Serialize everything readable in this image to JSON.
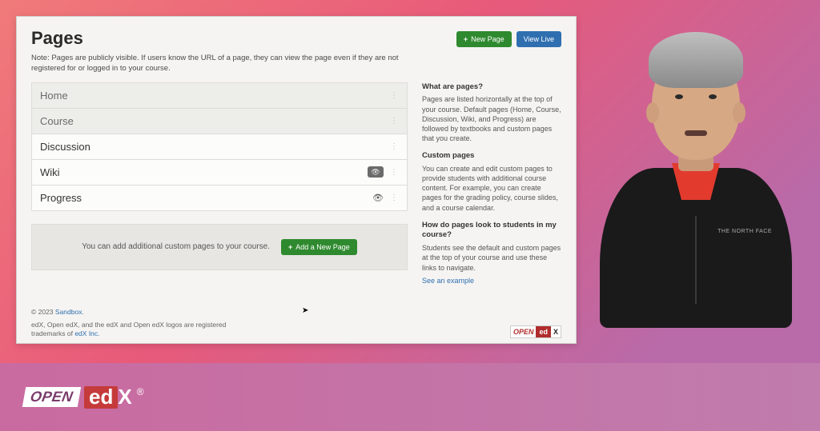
{
  "header": {
    "title": "Pages",
    "new_page_btn": "New Page",
    "view_live_btn": "View Live"
  },
  "note": "Note: Pages are publicly visible. If users know the URL of a page, they can view the page even if they are not registered for or logged in to your course.",
  "pages": [
    {
      "name": "Home",
      "active": false,
      "show_toggle": false,
      "show_eye": false
    },
    {
      "name": "Course",
      "active": false,
      "show_toggle": false,
      "show_eye": false
    },
    {
      "name": "Discussion",
      "active": true,
      "show_toggle": false,
      "show_eye": false
    },
    {
      "name": "Wiki",
      "active": true,
      "show_toggle": true,
      "show_eye": false
    },
    {
      "name": "Progress",
      "active": true,
      "show_toggle": false,
      "show_eye": true
    }
  ],
  "add_panel": {
    "hint": "You can add additional custom pages to your course.",
    "button": "Add a New Page"
  },
  "sidebar": {
    "h1": "What are pages?",
    "p1": "Pages are listed horizontally at the top of your course. Default pages (Home, Course, Discussion, Wiki, and Progress) are followed by textbooks and custom pages that you create.",
    "h2": "Custom pages",
    "p2": "You can create and edit custom pages to provide students with additional course content. For example, you can create pages for the grading policy, course slides, and a course calendar.",
    "h3": "How do pages look to students in my course?",
    "p3": "Students see the default and custom pages at the top of your course and use these links to navigate.",
    "link": "See an example"
  },
  "footer": {
    "copyright_prefix": "© 2023 ",
    "copyright_link": "Sandbox",
    "copyright_suffix": ".",
    "trademark_prefix": "edX, Open edX, and the edX and Open edX logos are registered trademarks of ",
    "trademark_link": "edX Inc.",
    "badge_open": "OPEN",
    "badge_ed": "ed",
    "badge_x": "X"
  },
  "brand": {
    "open": "OPEN",
    "ed": "ed",
    "x": "X",
    "reg": "®"
  },
  "presenter": {
    "logo_text": "THE\nNORTH\nFACE"
  }
}
